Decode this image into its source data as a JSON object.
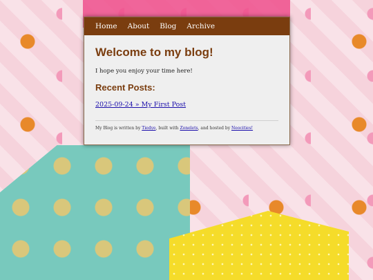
{
  "nav": {
    "items": [
      {
        "label": "Home"
      },
      {
        "label": "About"
      },
      {
        "label": "Blog"
      },
      {
        "label": "Archive"
      }
    ]
  },
  "main": {
    "title": "Welcome to my blog!",
    "intro": "I hope you enjoy your time here!",
    "recent_heading": "Recent Posts:",
    "posts": [
      {
        "label": "2025-09-24 » My First Post"
      }
    ]
  },
  "footer": {
    "text_1": "My Blog is written by ",
    "link_1": "Tiedye",
    "text_2": ", built with ",
    "link_2": "Zonelets",
    "text_3": ", and hosted by ",
    "link_3": "Neocities!"
  },
  "colors": {
    "nav_bg": "#7a3d0f",
    "heading": "#7a3d0f",
    "link": "#1a0dab",
    "panel_bg": "#efefef"
  }
}
